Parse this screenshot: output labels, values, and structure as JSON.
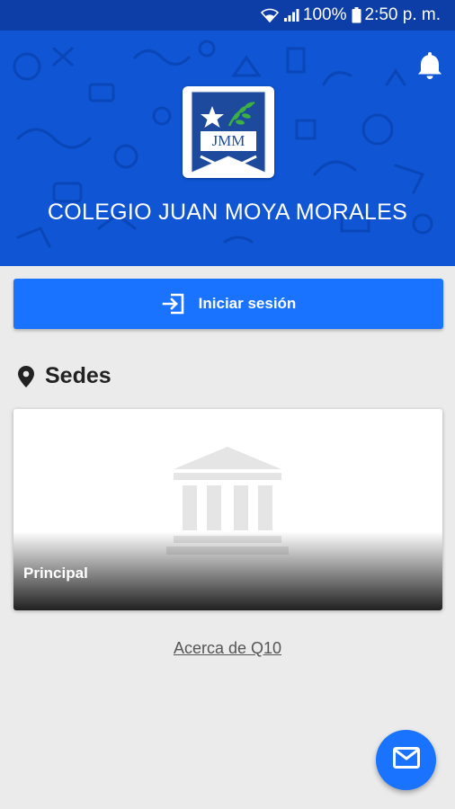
{
  "status_bar": {
    "battery": "100%",
    "time": "2:50 p. m.",
    "icons": [
      "wifi-icon",
      "signal-icon",
      "battery-icon"
    ]
  },
  "header": {
    "school_name": "COLEGIO JUAN MOYA MORALES",
    "logo_text": "JMM",
    "icons": [
      "bell-icon"
    ]
  },
  "login": {
    "label": "Iniciar sesión",
    "icon": "login-icon"
  },
  "sedes": {
    "title": "Sedes",
    "icon": "location-pin-icon",
    "items": [
      {
        "label": "Principal",
        "icon": "building-icon"
      }
    ]
  },
  "footer": {
    "about_link": "Acerca de Q10"
  },
  "fab": {
    "icon": "mail-icon"
  },
  "colors": {
    "header_blue": "#0f55d4",
    "status_blue": "#0d3ea8",
    "accent_blue": "#1a73ff",
    "background": "#ebebeb"
  }
}
